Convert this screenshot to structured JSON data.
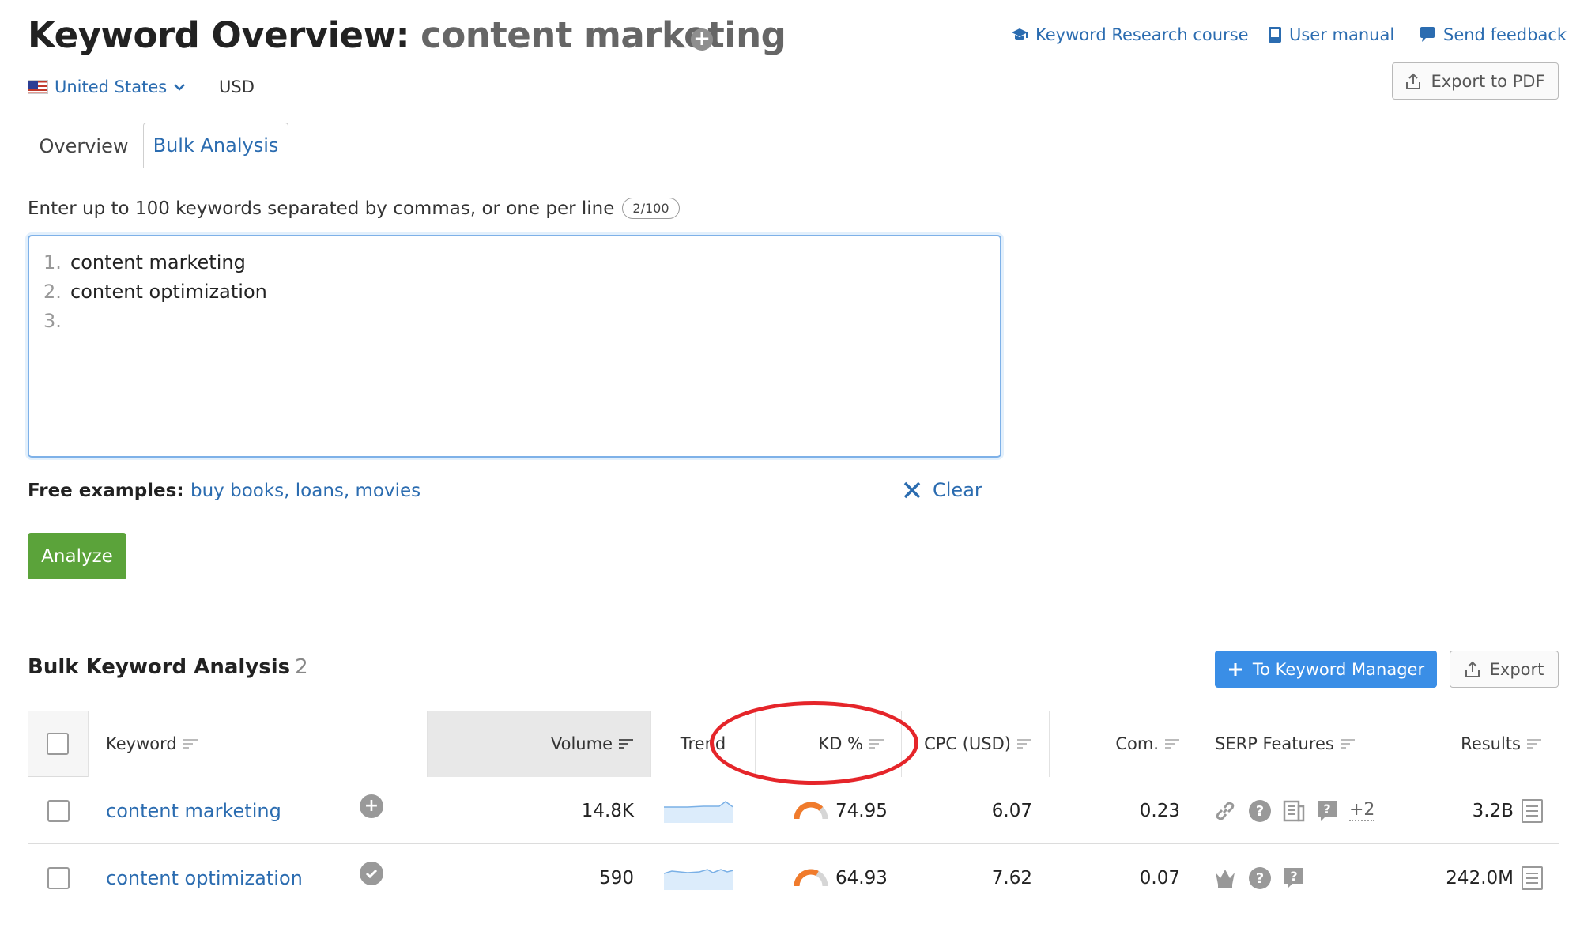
{
  "header": {
    "title_prefix": "Keyword Overview:",
    "title_keyword": "content marketing",
    "links": {
      "course": "Keyword Research course",
      "manual": "User manual",
      "feedback": "Send feedback"
    },
    "country": "United States",
    "currency": "USD",
    "export_pdf": "Export to PDF"
  },
  "tabs": [
    {
      "label": "Overview",
      "active": false
    },
    {
      "label": "Bulk Analysis",
      "active": true
    }
  ],
  "bulk_input": {
    "hint": "Enter up to 100 keywords separated by commas, or one per line",
    "counter": "2/100",
    "lines": [
      {
        "num": "1.",
        "text": "content marketing"
      },
      {
        "num": "2.",
        "text": "content optimization"
      },
      {
        "num": "3.",
        "text": ""
      }
    ],
    "free_examples_label": "Free examples:",
    "free_examples": "buy books, loans, movies",
    "clear_label": "Clear",
    "analyze_label": "Analyze"
  },
  "results": {
    "title": "Bulk Keyword Analysis",
    "count": "2",
    "to_keyword_manager": "To Keyword Manager",
    "export": "Export",
    "columns": {
      "keyword": "Keyword",
      "volume": "Volume",
      "trend": "Trend",
      "kd": "KD %",
      "cpc": "CPC (USD)",
      "com": "Com.",
      "serp": "SERP Features",
      "results": "Results"
    },
    "rows": [
      {
        "keyword": "content marketing",
        "volume": "14.8K",
        "kd": "74.95",
        "kd_fraction": 0.7495,
        "cpc": "6.07",
        "com": "0.23",
        "serp_extra": "+2",
        "results": "3.2B",
        "status_icon": "add-icon"
      },
      {
        "keyword": "content optimization",
        "volume": "590",
        "kd": "64.93",
        "kd_fraction": 0.6493,
        "cpc": "7.62",
        "com": "0.07",
        "serp_extra": "",
        "results": "242.0M",
        "status_icon": "check-icon"
      }
    ]
  },
  "colors": {
    "link": "#2b6cb0",
    "analyze": "#5ba33a",
    "primary_button": "#3a8ee6",
    "kd_gauge": "#f07b2c",
    "annotation": "#e5252a"
  }
}
